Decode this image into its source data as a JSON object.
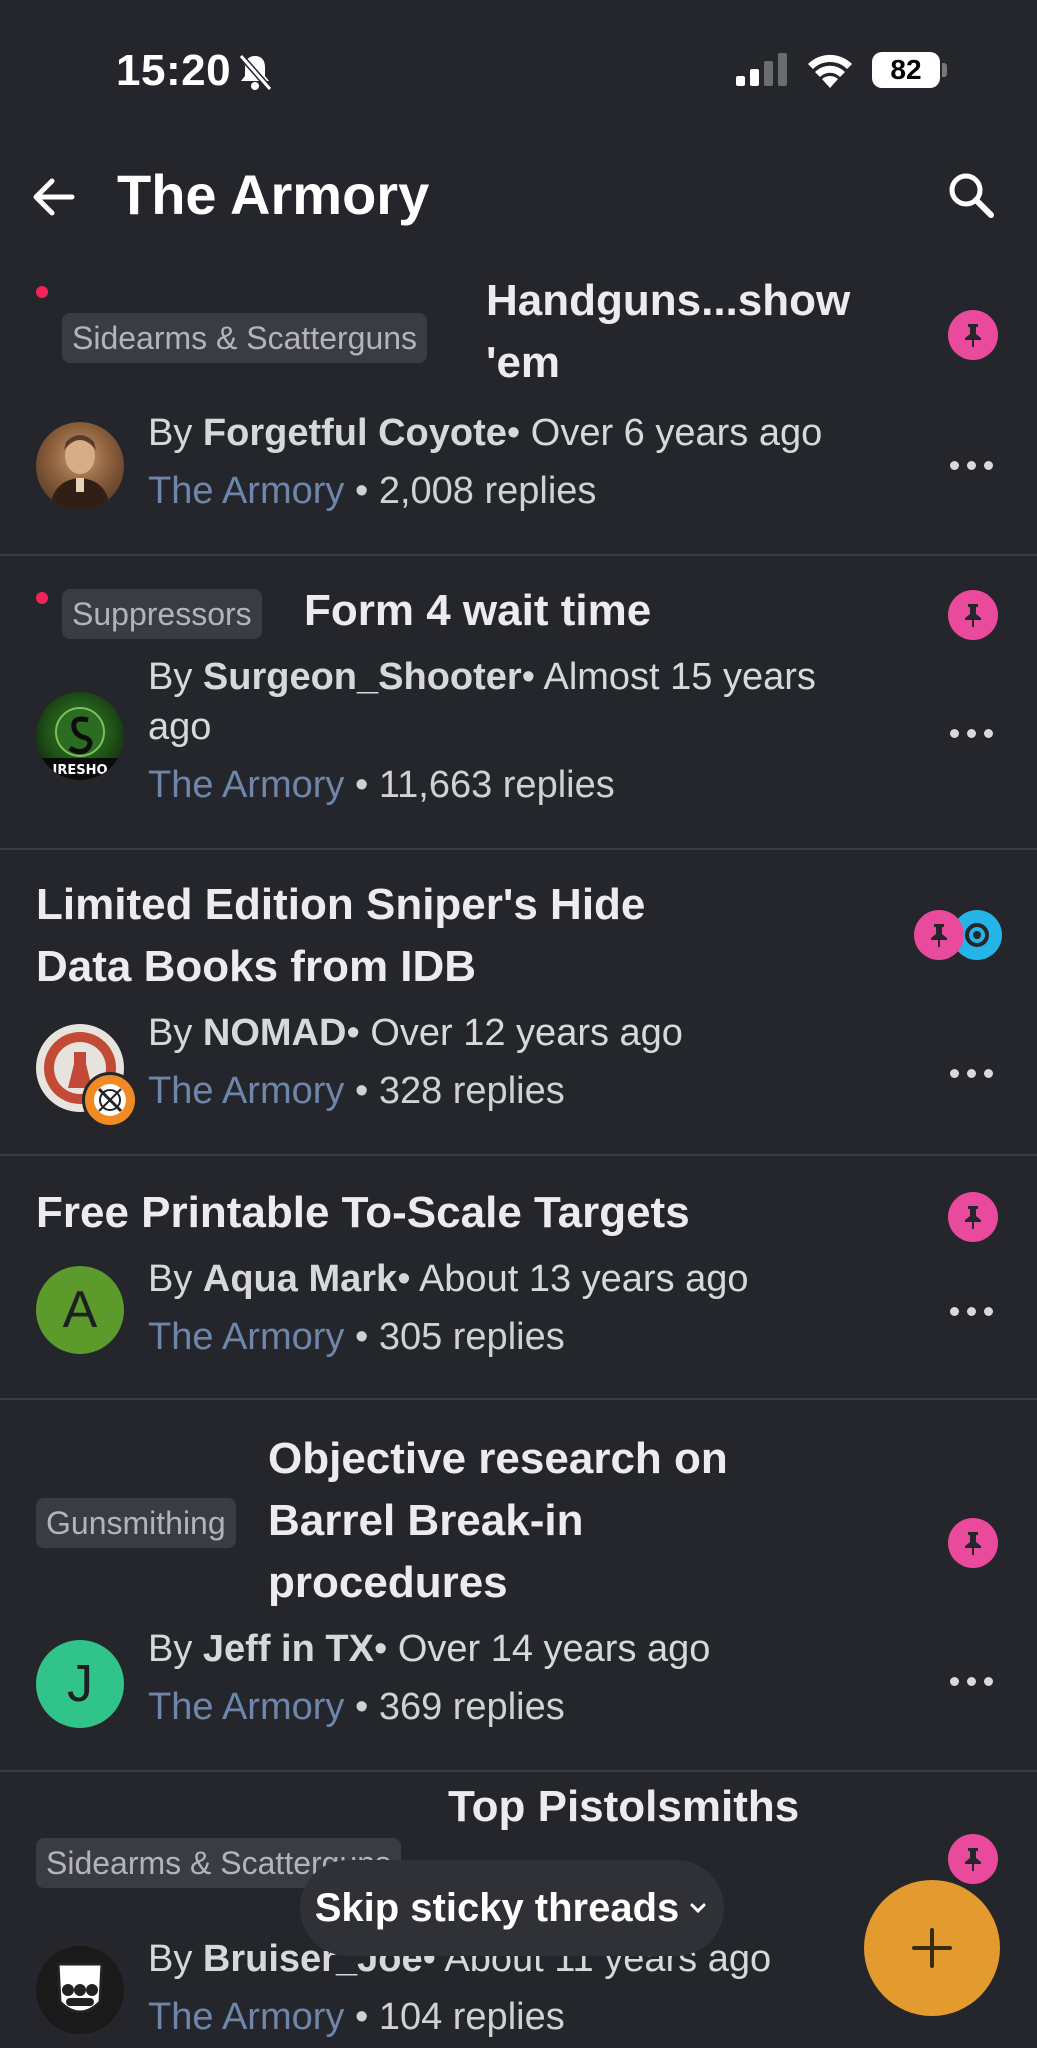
{
  "status_bar": {
    "time": "15:20",
    "battery": "82"
  },
  "header": {
    "title": "The Armory"
  },
  "threads": [
    {
      "tag": "Sidearms & Scatterguns",
      "title_line1": "Handguns...show",
      "title_line2": "'em",
      "author": "Forgetful Coyote",
      "age": "Over 6 years ago",
      "forum": "The Armory",
      "replies": "2,008 replies",
      "unread": true
    },
    {
      "tag": "Suppressors",
      "title_line1": "Form 4 wait time",
      "author": "Surgeon_Shooter",
      "age_line1": "Almost 15 years",
      "age_line2": "ago",
      "forum": "The Armory",
      "replies": "11,663 replies",
      "unread": true
    },
    {
      "title_line1": "Limited Edition Sniper's Hide",
      "title_line2": "Data Books from IDB",
      "author": "NOMAD",
      "age": "Over 12 years ago",
      "forum": "The Armory",
      "replies": "328 replies"
    },
    {
      "title_line1": "Free Printable To-Scale Targets",
      "author": "Aqua Mark",
      "avatar_letter": "A",
      "age": "About 13 years ago",
      "forum": "The Armory",
      "replies": "305 replies"
    },
    {
      "tag": "Gunsmithing",
      "title_line1": "Objective research on",
      "title_line2": "Barrel Break-in",
      "title_line3": "procedures",
      "author": "Jeff in TX",
      "avatar_letter": "J",
      "age": "Over 14 years ago",
      "forum": "The Armory",
      "replies": "369 replies"
    },
    {
      "tag": "Sidearms & Scatterguns",
      "title_line1": "Top Pistolsmiths",
      "author": "Bruiser_Joe",
      "age": "About 11 years ago",
      "forum": "The Armory",
      "replies": "104 replies"
    }
  ],
  "skip_button": {
    "label": "Skip sticky threads"
  },
  "separator": " • ",
  "colors": {
    "background": "#25262b",
    "pin": "#e94a9c",
    "watch": "#25b4e8",
    "forum_link": "#6d86aa",
    "fab": "#e39b2f",
    "unread": "#f0245a"
  }
}
